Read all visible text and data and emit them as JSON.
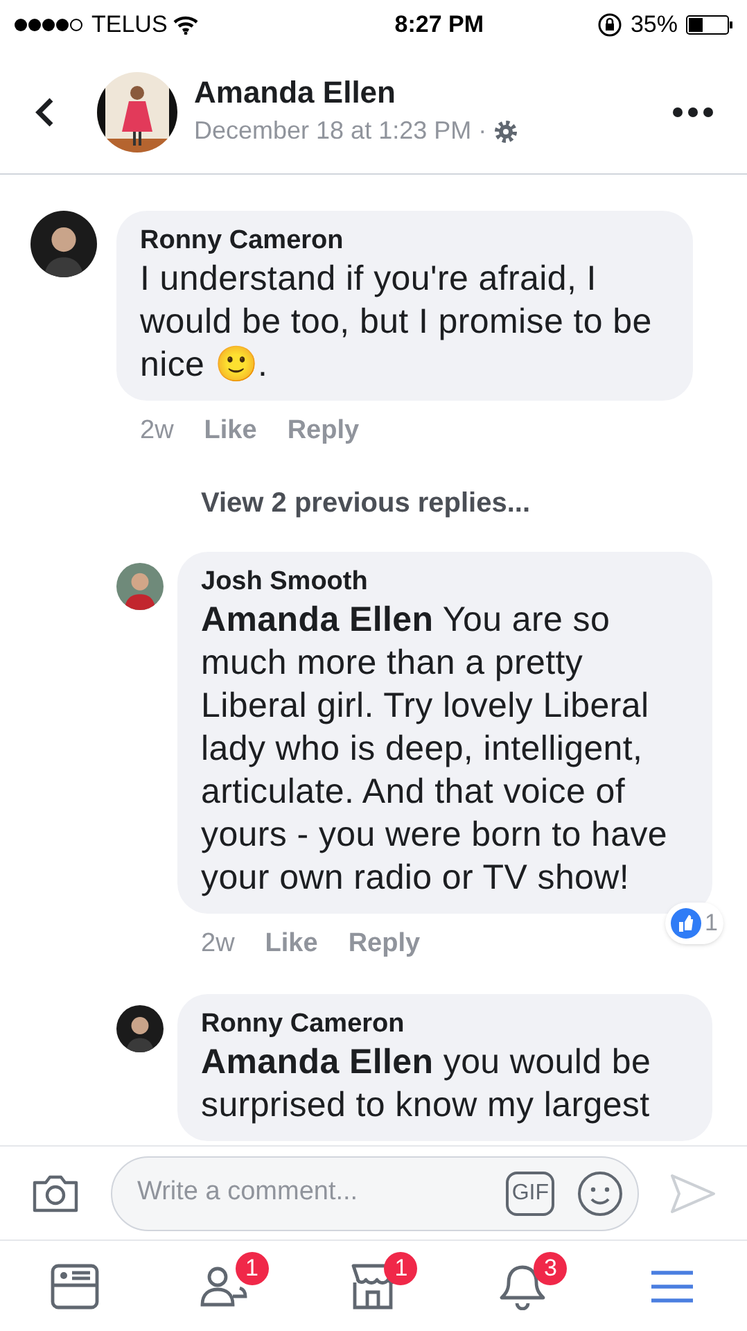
{
  "status_bar": {
    "carrier": "TELUS",
    "time": "8:27 PM",
    "battery": "35%"
  },
  "header": {
    "name": "Amanda Ellen",
    "date": "December 18 at 1:23 PM",
    "separator": "·"
  },
  "comments": [
    {
      "kind": "comment",
      "author": "Ronny Cameron",
      "text": "I understand if you're afraid, I would be too, but I promise to be nice 🙂.",
      "time": "2w",
      "actions": [
        "Like",
        "Reply"
      ]
    },
    {
      "kind": "more",
      "text": "View 2 previous replies..."
    },
    {
      "kind": "reply",
      "author": "Josh Smooth",
      "text": "**Amanda Ellen** You are so much more than a pretty Liberal girl. Try lovely Liberal lady who is deep, intelligent, articulate.  And that voice of yours - you were born to have your own radio or TV show!",
      "time": "2w",
      "actions": [
        "Like",
        "Reply"
      ],
      "reactions": "1"
    },
    {
      "kind": "reply",
      "author": "Ronny Cameron",
      "text": "**Amanda Ellen** you would be surprised to know my largest"
    }
  ],
  "composer": {
    "placeholder": "Write a comment...",
    "gif": "GIF"
  },
  "tab_bar": [
    {
      "kind": "feed"
    },
    {
      "kind": "friends",
      "badge": "1"
    },
    {
      "kind": "marketplace",
      "badge": "1"
    },
    {
      "kind": "notifications",
      "badge": "3"
    },
    {
      "kind": "menu"
    }
  ]
}
